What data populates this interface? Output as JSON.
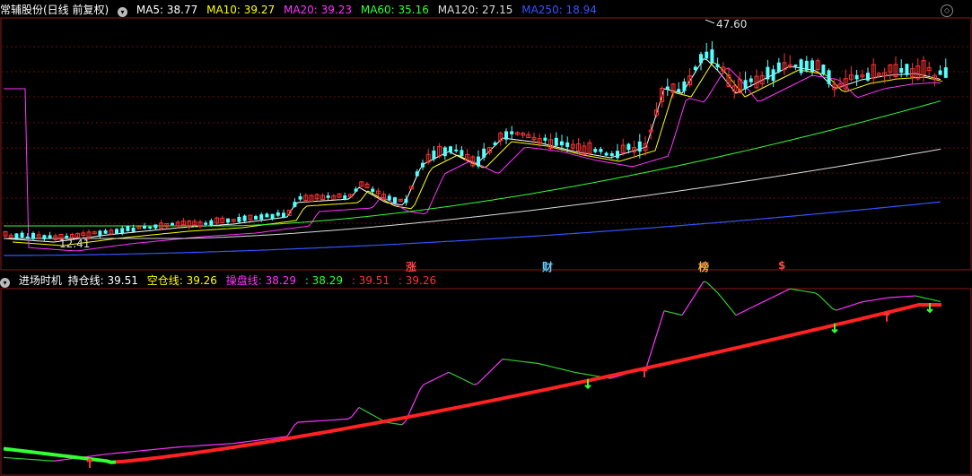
{
  "header": {
    "title": "常辅股份(日线 前复权)",
    "ma": [
      {
        "label": "MA5: 38.77",
        "color": "#ffffff"
      },
      {
        "label": "MA10: 39.27",
        "color": "#ffff00"
      },
      {
        "label": "MA20: 39.23",
        "color": "#ff33ff"
      },
      {
        "label": "MA60: 35.16",
        "color": "#33ff33"
      },
      {
        "label": "MA120: 27.15",
        "color": "#dddddd"
      },
      {
        "label": "MA250: 18.94",
        "color": "#3355ff"
      }
    ]
  },
  "price_chart": {
    "high_label": "47.60",
    "low_label": "12.41",
    "events": [
      {
        "label": "涨",
        "color": "#ff4444"
      },
      {
        "label": "财",
        "color": "#66ccff"
      },
      {
        "label": "榜",
        "color": "#ffaa44"
      },
      {
        "label": "$",
        "color": "#ff4444"
      }
    ]
  },
  "indicator": {
    "title": "进场时机",
    "items": [
      {
        "label": "持仓线: 39.51",
        "color": "#ffffff"
      },
      {
        "label": "空仓线: 39.26",
        "color": "#ffff00"
      },
      {
        "label": "操盘线: 38.29",
        "color": "#ff33ff"
      },
      {
        "label": ": 38.29",
        "color": "#33ff33"
      },
      {
        "label": ": 39.51",
        "color": "#ff3333"
      },
      {
        "label": ": 39.26",
        "color": "#ff3333"
      }
    ]
  },
  "colors": {
    "up": "#ff3333",
    "down": "#54ffff",
    "grid": "#7a1010"
  }
}
